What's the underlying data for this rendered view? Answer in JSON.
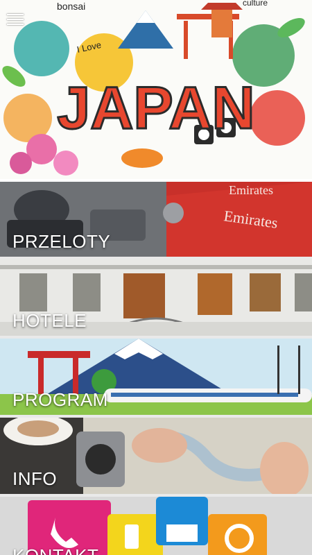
{
  "header": {
    "menu_icon": "hamburger-menu-icon",
    "banner": {
      "title": "JAPAN",
      "words": [
        "bonsai",
        "I Love",
        "culture"
      ]
    }
  },
  "tiles": [
    {
      "label": "PRZELOTY",
      "brand_text": [
        "Emirates",
        "Emirates"
      ]
    },
    {
      "label": "HOTELE"
    },
    {
      "label": "PROGRAM"
    },
    {
      "label": "INFO"
    },
    {
      "label": "KONTAKT",
      "icons": [
        "phone-icon",
        "mobile-icon",
        "mail-icon",
        "at-sign-icon"
      ]
    }
  ]
}
